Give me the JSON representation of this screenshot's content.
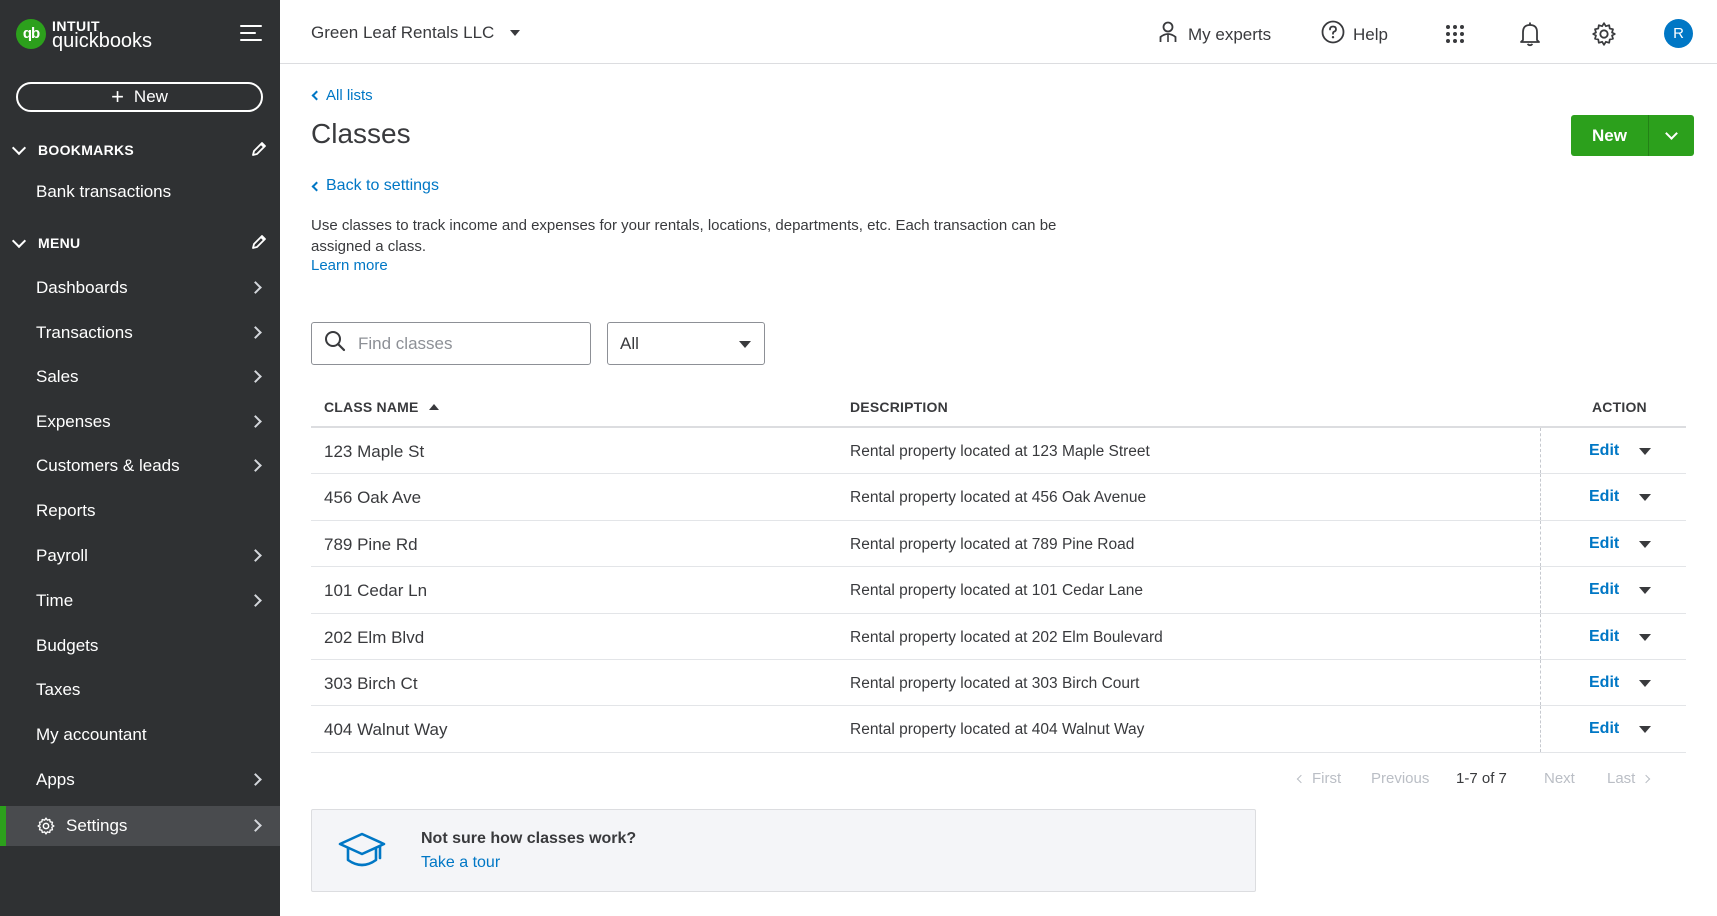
{
  "brand": {
    "line1": "INTUIT",
    "line2": "quickbooks",
    "mark": "qb",
    "color": "#2ca01c"
  },
  "sidebar": {
    "new_label": "New",
    "bookmarks_label": "BOOKMARKS",
    "bookmarks": [
      {
        "label": "Bank transactions"
      }
    ],
    "menu_label": "MENU",
    "items": [
      {
        "label": "Dashboards",
        "has_arrow": true
      },
      {
        "label": "Transactions",
        "has_arrow": true
      },
      {
        "label": "Sales",
        "has_arrow": true
      },
      {
        "label": "Expenses",
        "has_arrow": true
      },
      {
        "label": "Customers & leads",
        "has_arrow": true
      },
      {
        "label": "Reports",
        "has_arrow": false
      },
      {
        "label": "Payroll",
        "has_arrow": true
      },
      {
        "label": "Time",
        "has_arrow": true
      },
      {
        "label": "Budgets",
        "has_arrow": false
      },
      {
        "label": "Taxes",
        "has_arrow": false
      },
      {
        "label": "My accountant",
        "has_arrow": false
      },
      {
        "label": "Apps",
        "has_arrow": true
      },
      {
        "label": "Settings",
        "has_arrow": true,
        "active": true
      }
    ]
  },
  "topbar": {
    "company": "Green Leaf Rentals LLC",
    "experts": "My experts",
    "help": "Help",
    "avatar": "R"
  },
  "page": {
    "all_lists": "All lists",
    "title": "Classes",
    "back": "Back to settings",
    "intro": "Use classes to track income and expenses for your rentals, locations, departments, etc. Each transaction can be assigned a class.",
    "learn_more": "Learn more",
    "new_button": "New",
    "search_placeholder": "Find classes",
    "filter_value": "All"
  },
  "table": {
    "headers": {
      "name": "CLASS NAME",
      "description": "DESCRIPTION",
      "action": "ACTION"
    },
    "rows": [
      {
        "name": "123 Maple St",
        "description": "Rental property located at 123 Maple Street",
        "action": "Edit"
      },
      {
        "name": "456 Oak Ave",
        "description": "Rental property located at 456 Oak Avenue",
        "action": "Edit"
      },
      {
        "name": "789 Pine Rd",
        "description": "Rental property located at 789 Pine Road",
        "action": "Edit"
      },
      {
        "name": "101 Cedar Ln",
        "description": "Rental property located at 101 Cedar Lane",
        "action": "Edit"
      },
      {
        "name": "202 Elm Blvd",
        "description": "Rental property located at 202 Elm Boulevard",
        "action": "Edit"
      },
      {
        "name": "303 Birch Ct",
        "description": "Rental property located at 303 Birch Court",
        "action": "Edit"
      },
      {
        "name": "404 Walnut Way",
        "description": "Rental property located at 404 Walnut Way",
        "action": "Edit"
      }
    ]
  },
  "pager": {
    "first": "First",
    "previous": "Previous",
    "range": "1-7 of 7",
    "next": "Next",
    "last": "Last"
  },
  "tour": {
    "question": "Not sure how classes work?",
    "link": "Take a tour"
  }
}
